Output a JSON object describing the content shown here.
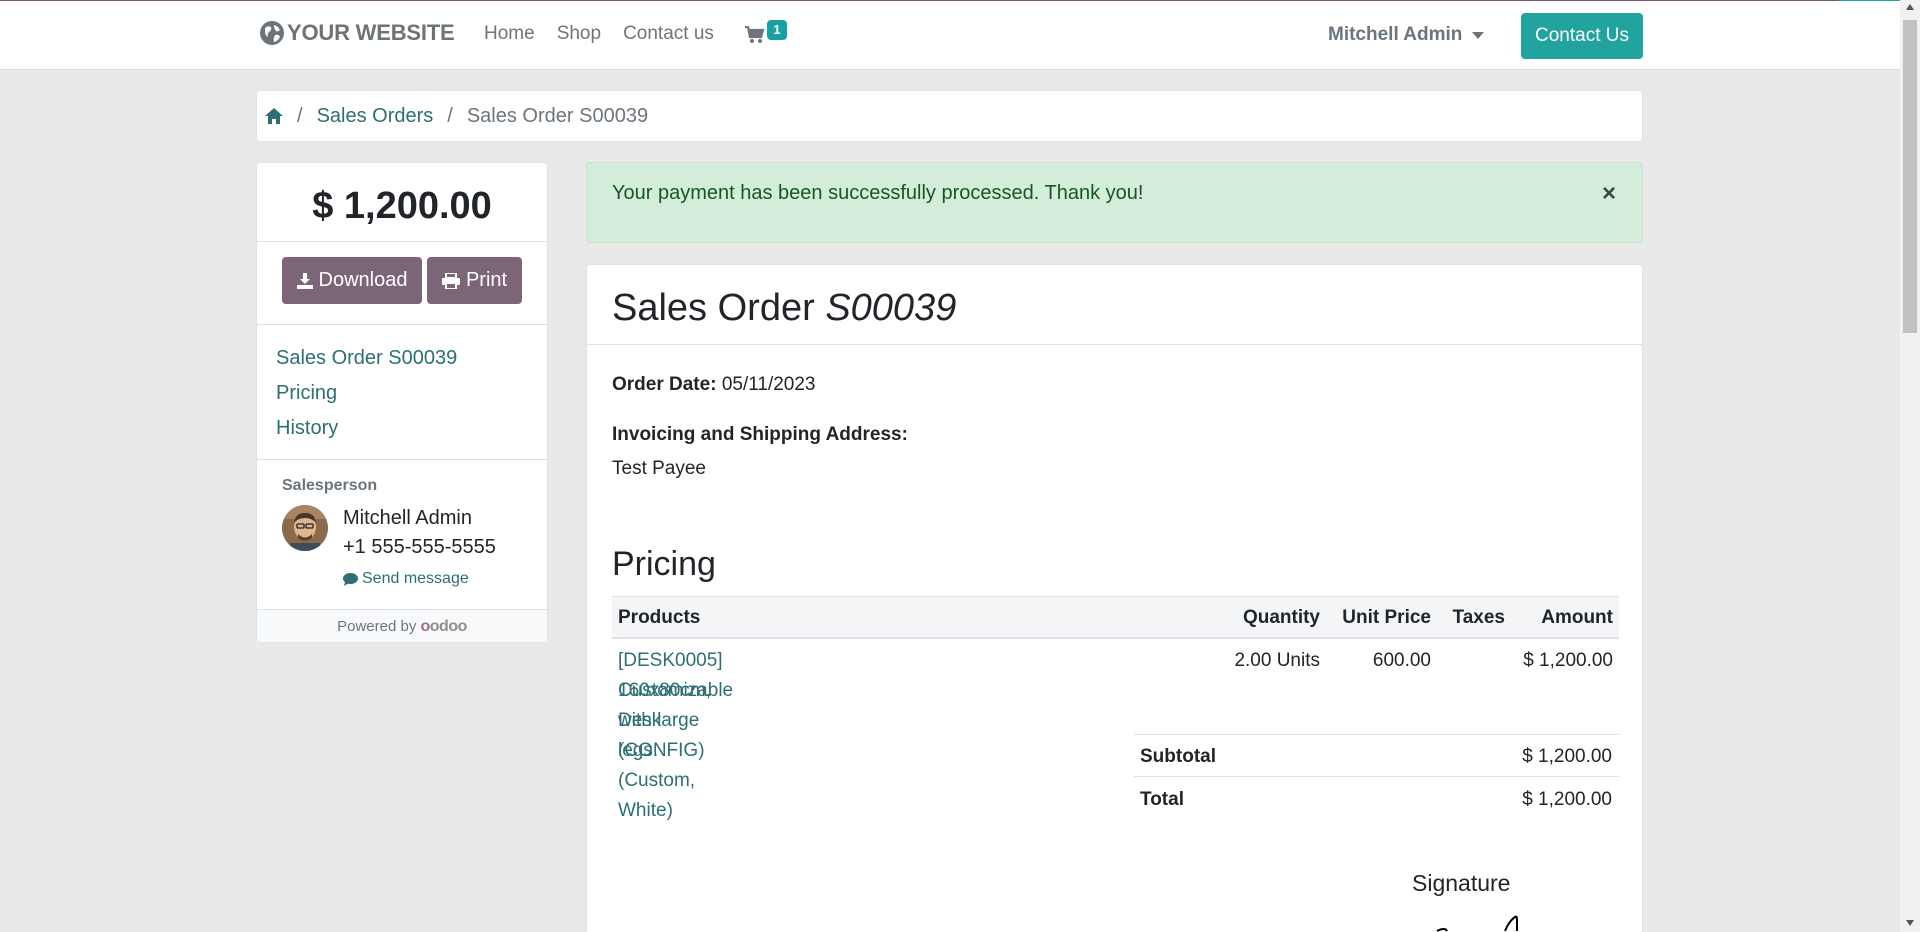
{
  "brand": {
    "name": "YOUR WEBSITE",
    "icon": "globe-icon"
  },
  "nav": {
    "links": [
      "Home",
      "Shop",
      "Contact us"
    ],
    "cart_count": "1",
    "user": "Mitchell Admin",
    "contact_button": "Contact Us"
  },
  "breadcrumb": {
    "home_icon": "home-icon",
    "items": [
      "Sales Orders",
      "Sales Order S00039"
    ]
  },
  "sidebar": {
    "amount": "$ 1,200.00",
    "download_label": "Download",
    "print_label": "Print",
    "nav_items": [
      "Sales Order S00039",
      "Pricing",
      "History"
    ],
    "salesperson_label": "Salesperson",
    "salesperson_name": "Mitchell Admin",
    "salesperson_phone": "+1 555-555-5555",
    "send_message": "Send message",
    "powered_by": "Powered by",
    "powered_brand": "odoo"
  },
  "alert": {
    "message": "Your payment has been successfully processed. Thank you!",
    "close": "×"
  },
  "order": {
    "title_prefix": "Sales Order",
    "number": "S00039",
    "order_date_label": "Order Date:",
    "order_date": "05/11/2023",
    "address_label": "Invoicing and Shipping Address:",
    "address_name": "Test Payee",
    "pricing_title": "Pricing",
    "columns": [
      "Products",
      "Quantity",
      "Unit Price",
      "Taxes",
      "Amount"
    ],
    "lines": [
      {
        "product_line1": "[DESK0005] Customizable Desk (CONFIG) (Custom, White)",
        "product_line2": "160x80cm, with large legs.",
        "quantity": "2.00 Units",
        "unit_price": "600.00",
        "taxes": "",
        "amount": "$ 1,200.00"
      }
    ],
    "subtotal_label": "Subtotal",
    "subtotal": "$ 1,200.00",
    "total_label": "Total",
    "total": "$ 1,200.00",
    "signature_label": "Signature"
  },
  "colors": {
    "primary_teal": "#22a3a0",
    "link_teal": "#2d6f73",
    "action_purple": "#7c6576",
    "alert_bg": "#d4edda",
    "alert_text": "#155724"
  }
}
